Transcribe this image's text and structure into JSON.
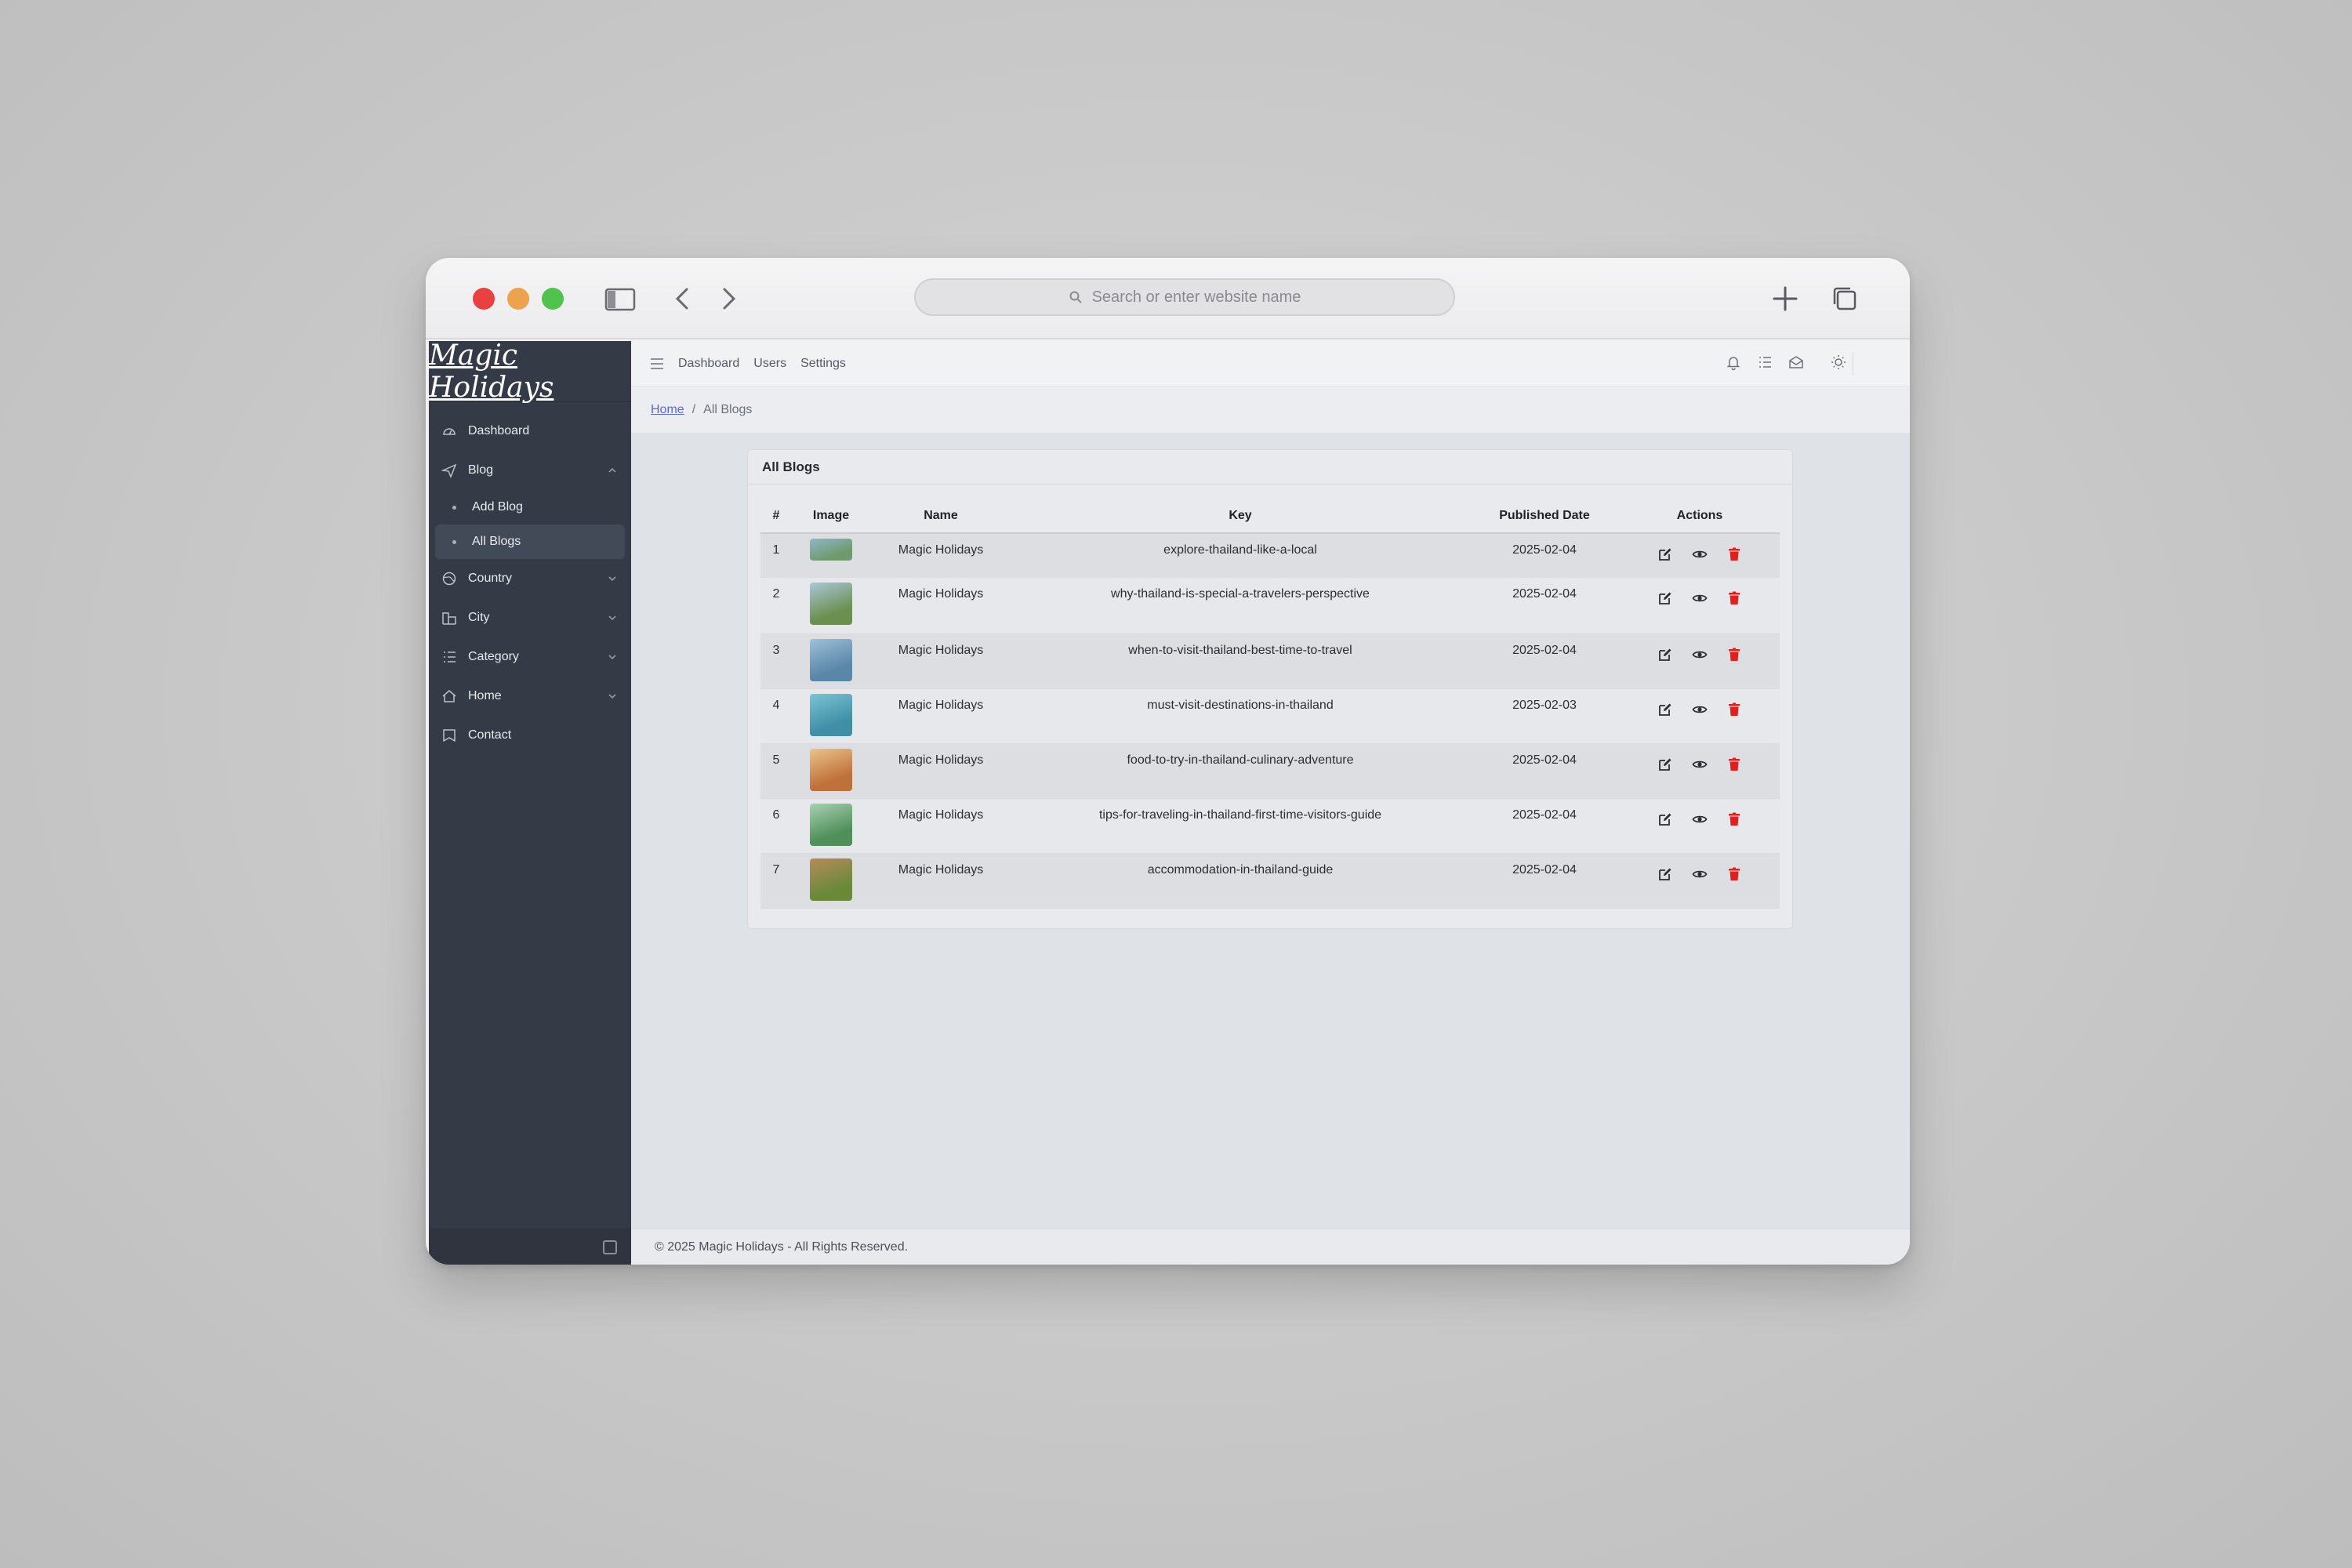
{
  "browser": {
    "url_placeholder": "Search or enter website name"
  },
  "sidebar": {
    "brand": "Magic Holidays",
    "items": [
      {
        "label": "Dashboard",
        "icon": "dashboard-icon"
      },
      {
        "label": "Blog",
        "icon": "send-icon",
        "expanded": true,
        "children": [
          {
            "label": "Add Blog"
          },
          {
            "label": "All Blogs",
            "active": true
          }
        ]
      },
      {
        "label": "Country",
        "icon": "globe-icon"
      },
      {
        "label": "City",
        "icon": "buildings-icon"
      },
      {
        "label": "Category",
        "icon": "list-icon"
      },
      {
        "label": "Home",
        "icon": "home-icon"
      },
      {
        "label": "Contact",
        "icon": "contact-icon"
      }
    ]
  },
  "topbar": {
    "links": [
      "Dashboard",
      "Users",
      "Settings"
    ],
    "icons": [
      "bell-icon",
      "list-icon",
      "mail-icon",
      "sun-icon"
    ]
  },
  "breadcrumb": {
    "home": "Home",
    "separator": "/",
    "current": "All Blogs"
  },
  "card": {
    "title": "All Blogs",
    "columns": [
      "#",
      "Image",
      "Name",
      "Key",
      "Published Date",
      "Actions"
    ],
    "rows": [
      {
        "num": "1",
        "name": "Magic Holidays",
        "key": "explore-thailand-like-a-local",
        "date": "2025-02-04",
        "img": [
          "#6f9a6e",
          "#8fb7c9"
        ]
      },
      {
        "num": "2",
        "name": "Magic Holidays",
        "key": "why-thailand-is-special-a-travelers-perspective",
        "date": "2025-02-04",
        "img": [
          "#6b8f4e",
          "#a9c7d8"
        ]
      },
      {
        "num": "3",
        "name": "Magic Holidays",
        "key": "when-to-visit-thailand-best-time-to-travel",
        "date": "2025-02-04",
        "img": [
          "#5a86a8",
          "#9cc0da"
        ]
      },
      {
        "num": "4",
        "name": "Magic Holidays",
        "key": "must-visit-destinations-in-thailand",
        "date": "2025-02-03",
        "img": [
          "#3f8fa6",
          "#7cc3d6"
        ]
      },
      {
        "num": "5",
        "name": "Magic Holidays",
        "key": "food-to-try-in-thailand-culinary-adventure",
        "date": "2025-02-04",
        "img": [
          "#c0703a",
          "#e9c48a"
        ]
      },
      {
        "num": "6",
        "name": "Magic Holidays",
        "key": "tips-for-traveling-in-thailand-first-time-visitors-guide",
        "date": "2025-02-04",
        "img": [
          "#4f8f5a",
          "#a8d0b0"
        ]
      },
      {
        "num": "7",
        "name": "Magic Holidays",
        "key": "accommodation-in-thailand-guide",
        "date": "2025-02-04",
        "img": [
          "#6a8a3a",
          "#b68a5a"
        ]
      }
    ],
    "action_icons": [
      "edit-icon",
      "eye-icon",
      "trash-icon"
    ]
  },
  "colors": {
    "sidebar_bg": "#343a46",
    "delete_red": "#e0201e",
    "link_blue": "#5b6bd6"
  },
  "footer": {
    "text": "© 2025 Magic Holidays - All Rights Reserved."
  }
}
